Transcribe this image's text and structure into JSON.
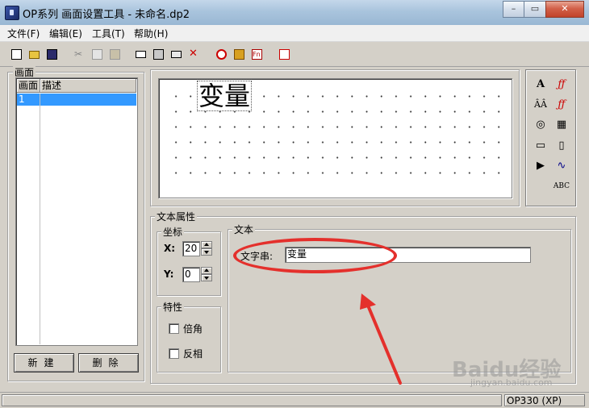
{
  "window": {
    "title": "OP系列 画面设置工具 - 未命名.dp2"
  },
  "menu": {
    "items": [
      "文件(F)",
      "编辑(E)",
      "工具(T)",
      "帮助(H)"
    ]
  },
  "toolbar": {
    "buttons": [
      "new-file-icon",
      "open-folder-icon",
      "save-icon",
      "cut-icon",
      "copy-icon",
      "paste-icon",
      "screen-icon",
      "screen-properties-icon",
      "screen-copy-icon",
      "screen-delete-icon",
      "alarm-clock-icon",
      "home-screen-icon",
      "function-key-icon",
      "download-icon"
    ]
  },
  "screens": {
    "group_label": "画面",
    "columns": [
      "画面",
      "描述"
    ],
    "rows": [
      {
        "id": "1",
        "description": ""
      }
    ],
    "new_button": "新建",
    "delete_button": "删除"
  },
  "canvas": {
    "text_object": "变量"
  },
  "palette": {
    "tools": [
      "A",
      "ƒƒ",
      "ÂÂ",
      "ƒƒ",
      "◎",
      "▦",
      "▭",
      "▯",
      "▶",
      "∿",
      "ABC"
    ]
  },
  "text_properties": {
    "group_label": "文本属性",
    "coords_label": "坐标",
    "x_label": "X:",
    "x_value": "20",
    "y_label": "Y:",
    "y_value": "0",
    "attrs_label": "特性",
    "double_angle_label": "倍角",
    "double_angle_checked": false,
    "invert_label": "反相",
    "invert_checked": false,
    "text_group_label": "文本",
    "string_label": "文字串:",
    "string_value": "变量"
  },
  "status": {
    "model": "OP330 (XP)"
  },
  "watermark": {
    "brand": "Baidu经验",
    "site": "jingyan.baidu.com"
  },
  "colors": {
    "annotation": "#e4302c",
    "selection": "#3399ff"
  }
}
